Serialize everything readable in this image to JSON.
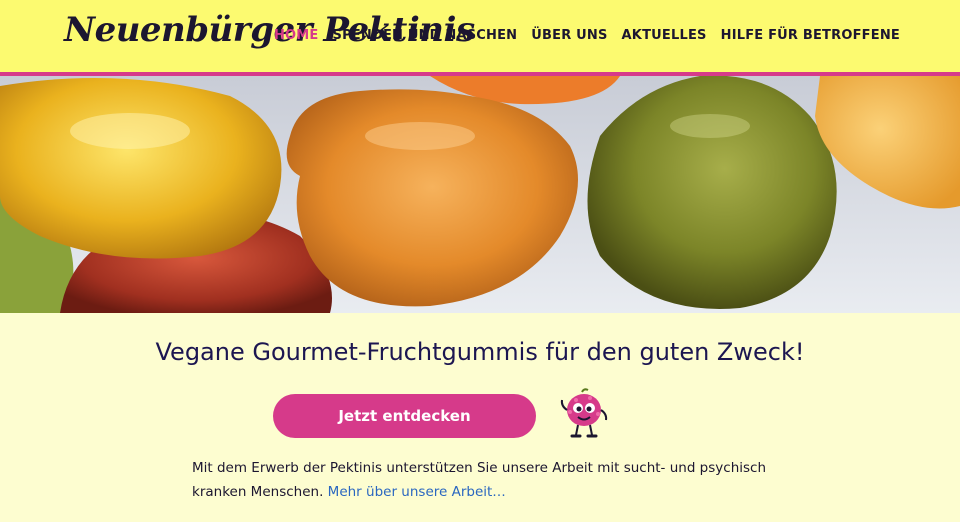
{
  "brand": {
    "logo_text": "Neuenbürger Pektinis"
  },
  "nav": {
    "items": [
      {
        "label": "HOME",
        "active": true
      },
      {
        "label": "SPENDEN UND NASCHEN",
        "active": false
      },
      {
        "label": "ÜBER UNS",
        "active": false
      },
      {
        "label": "AKTUELLES",
        "active": false
      },
      {
        "label": "HILFE FÜR BETROFFENE",
        "active": false
      }
    ]
  },
  "hero": {
    "image": "gummy-candies-photo"
  },
  "main": {
    "tagline": "Vegane Gourmet-Fruchtgummis für den guten Zweck!",
    "cta_label": "Jetzt entdecken",
    "mascot": "raspberry-mascot-icon",
    "body_text": "Mit dem Erwerb der Pektinis unterstützen Sie unsere Arbeit mit sucht- und psychisch kranken Menschen.",
    "more_link": "Mehr über unsere Arbeit…"
  },
  "colors": {
    "header_bg": "#fcfa70",
    "accent": "#d63a8a",
    "page_bg": "#fdfdd0",
    "text_dark": "#1c1651",
    "link": "#2a67c0"
  }
}
